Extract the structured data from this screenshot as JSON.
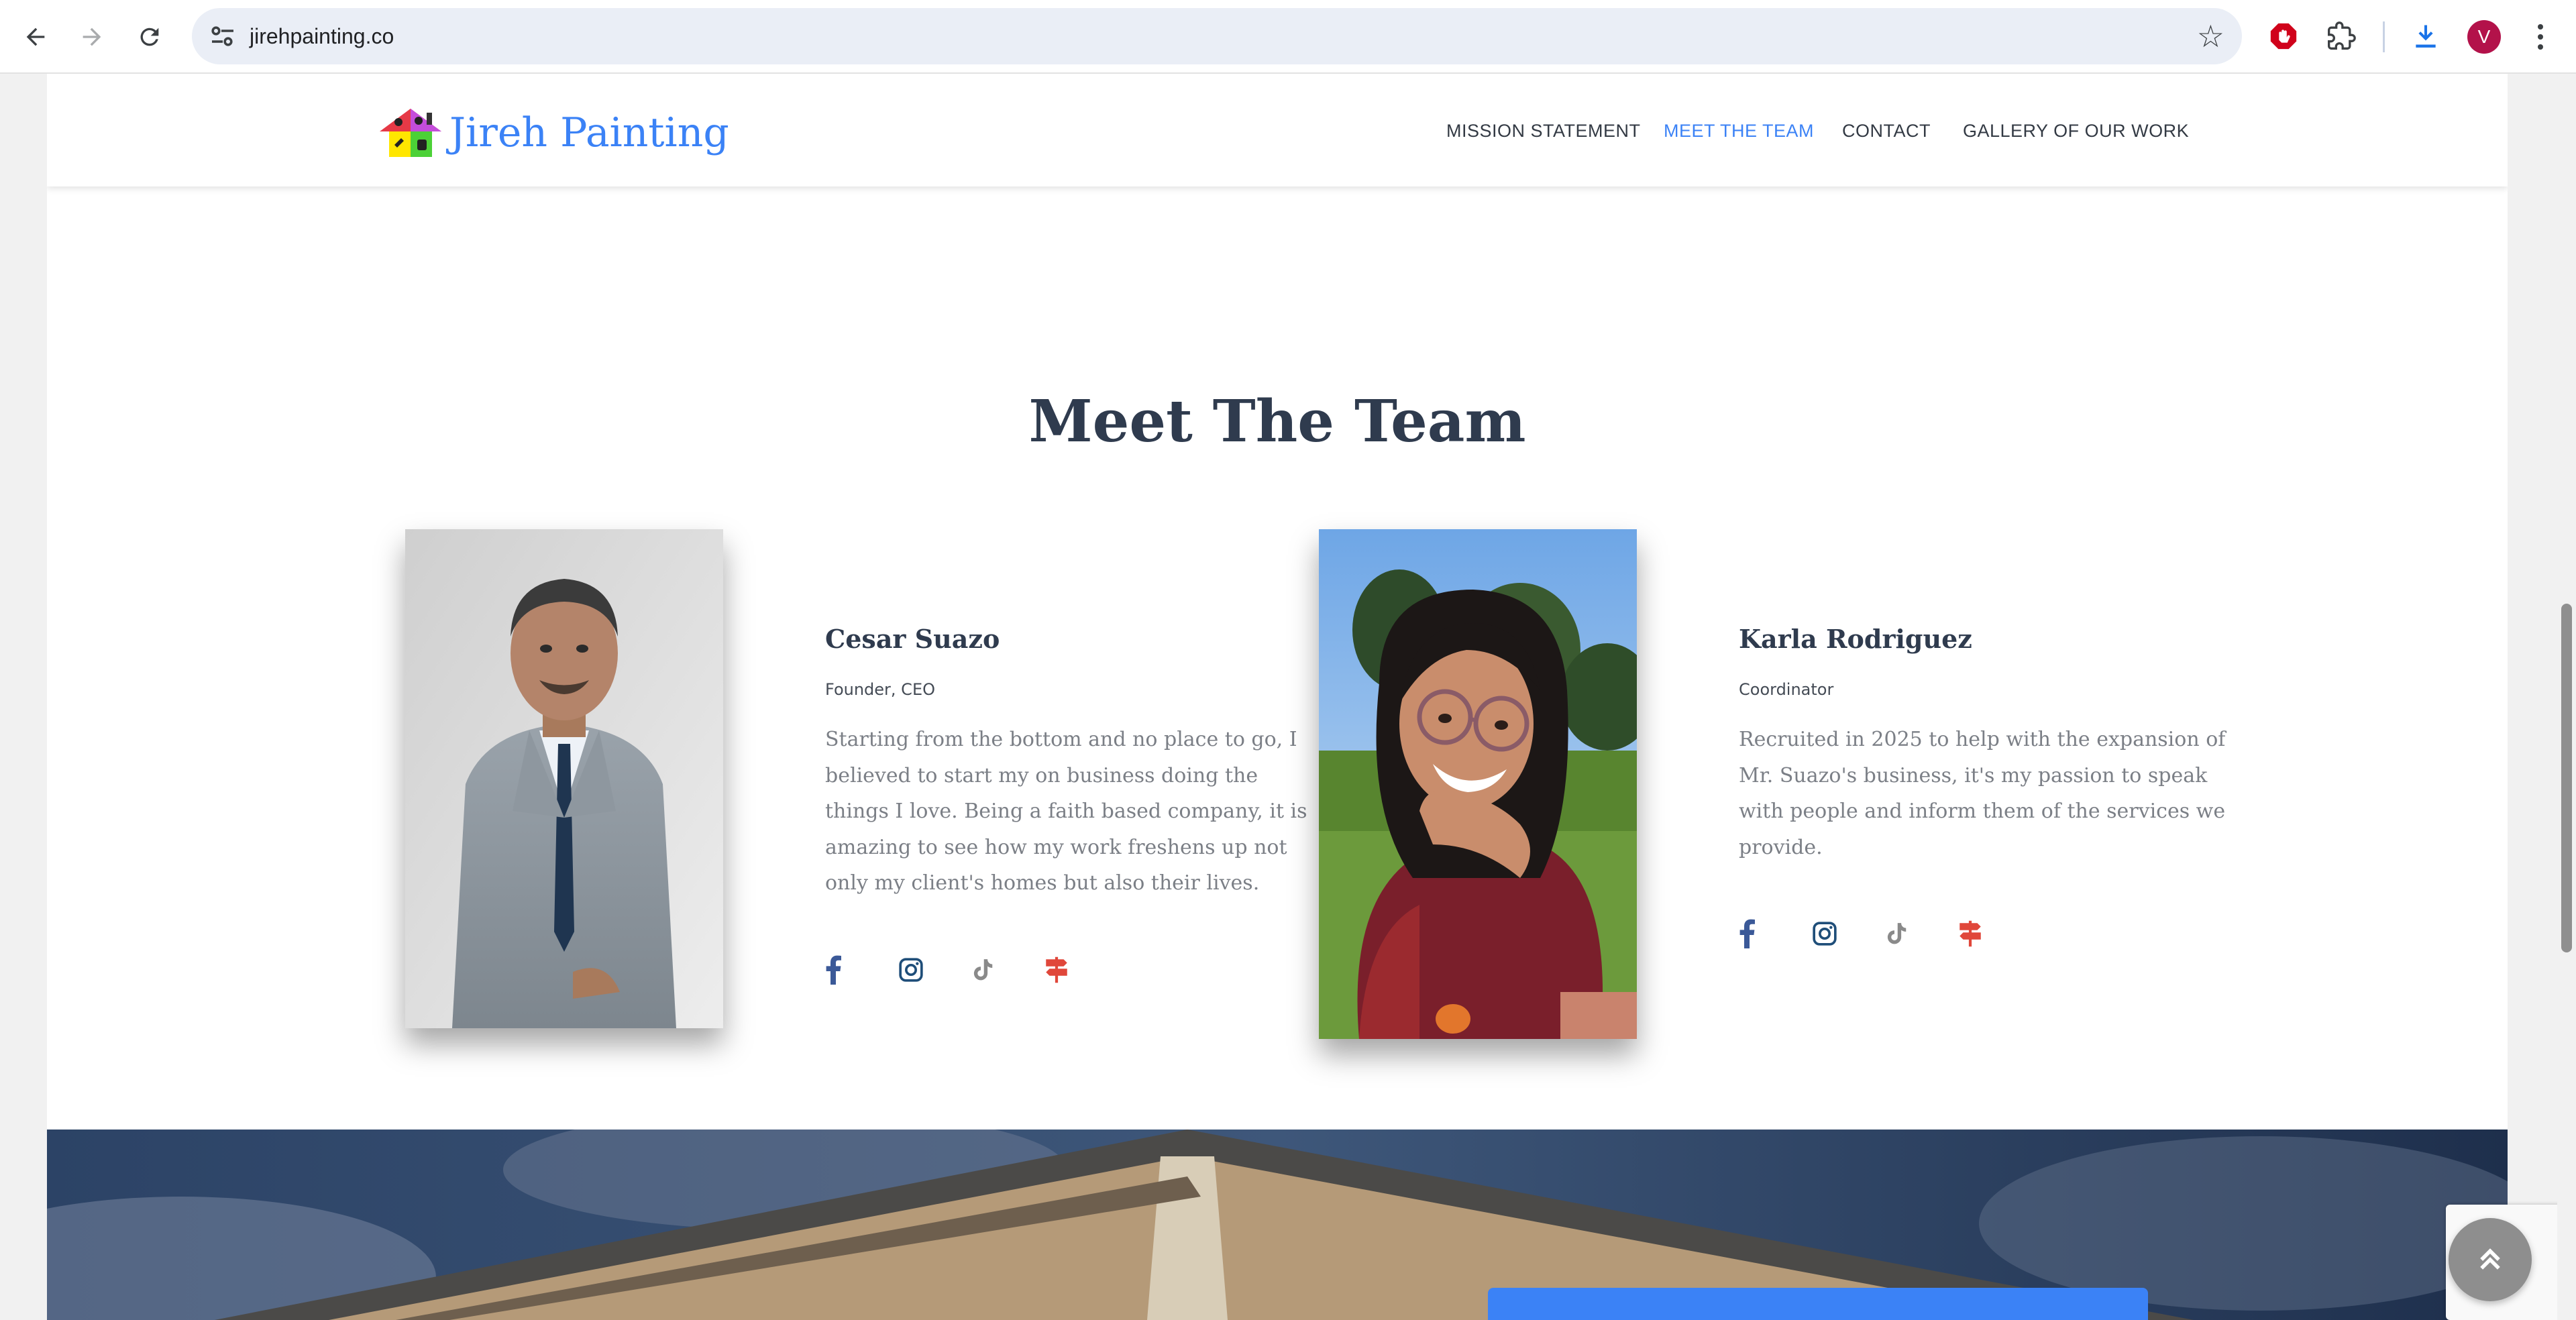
{
  "browser": {
    "url": "jirehpainting.co",
    "profile_initial": "V",
    "icons": {
      "back": "arrow-left-icon",
      "forward": "arrow-right-icon",
      "reload": "reload-icon",
      "site_settings": "tune-icon",
      "bookmark": "star-icon",
      "extension_adblock": "adblock-icon",
      "extensions": "puzzle-icon",
      "downloads": "download-icon",
      "menu": "kebab-menu-icon"
    }
  },
  "site": {
    "brand": "Jireh Painting",
    "brand_color": "#3b82f6",
    "nav": [
      {
        "label": "MISSION STATEMENT",
        "active": false
      },
      {
        "label": "MEET THE TEAM",
        "active": true
      },
      {
        "label": "CONTACT",
        "active": false
      },
      {
        "label": "GALLERY OF OUR WORK",
        "active": false
      }
    ]
  },
  "team": {
    "title": "Meet The Team",
    "members": [
      {
        "name": "Cesar Suazo",
        "role": "Founder, CEO",
        "bio_lines": [
          "Starting from the bottom and no place to go, I",
          "believed to start my on business doing the",
          "things I love. Being a faith based company, it is",
          "amazing to see how my work freshens up not",
          "only my client's homes but also their lives."
        ],
        "socials": [
          "facebook-icon",
          "instagram-icon",
          "tiktok-icon",
          "signpost-icon"
        ]
      },
      {
        "name": "Karla Rodriguez",
        "role": "Coordinator",
        "bio_lines": [
          "Recruited in 2025 to help with the expansion of",
          "Mr. Suazo's business, it's my passion to speak",
          "with people and inform them of the services we",
          "provide."
        ],
        "socials": [
          "facebook-icon",
          "instagram-icon",
          "tiktok-icon",
          "signpost-icon"
        ]
      }
    ]
  },
  "colors": {
    "heading": "#2f3b4e",
    "body_text": "#7b7f86",
    "facebook": "#3b5998",
    "instagram": "#1f4e79",
    "tiktok": "#8a8a8a",
    "signpost": "#e0473a"
  }
}
